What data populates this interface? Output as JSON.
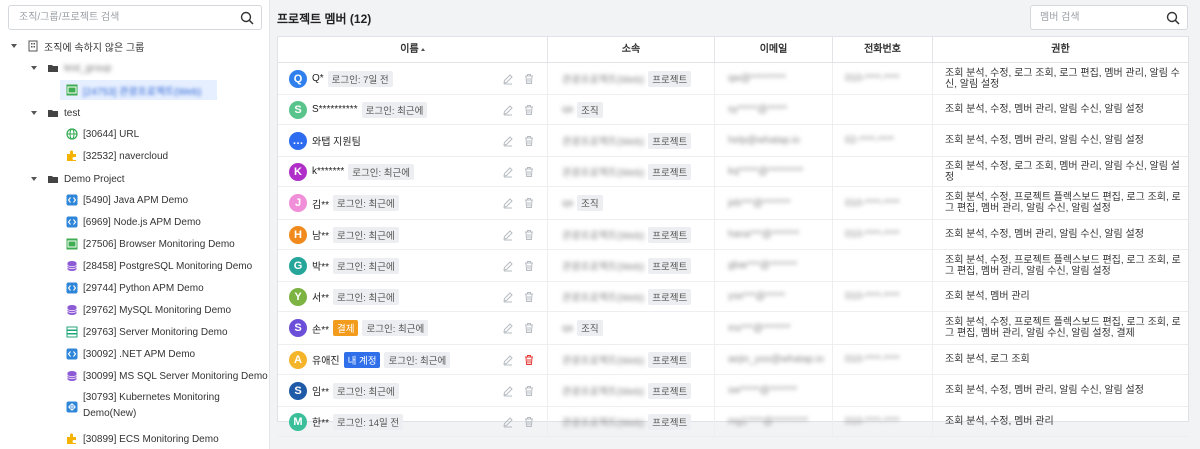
{
  "sidebar": {
    "search_placeholder": "조직/그룹/프로젝트 검색",
    "root_label": "조직에 속하지 않은 그룹",
    "group1_label": "test_group",
    "group1_project": "[24753] 관광프로젝트(Web)",
    "test_label": "test",
    "test_items": [
      "[30644] URL",
      "[32532] navercloud"
    ],
    "demo_label": "Demo Project",
    "demo_items": [
      "[5490] Java APM Demo",
      "[6969] Node.js APM Demo",
      "[27506] Browser Monitoring Demo",
      "[28458] PostgreSQL Monitoring Demo",
      "[29744] Python APM Demo",
      "[29762] MySQL Monitoring Demo",
      "[29763] Server Monitoring Demo",
      "[30092] .NET APM Demo",
      "[30099] MS SQL Server Monitoring Demo"
    ],
    "k8s_line1": "[30793] Kubernetes Monitoring",
    "k8s_line2": "Demo(New)",
    "ecs_label": "[30899] ECS Monitoring Demo"
  },
  "main": {
    "title": "프로젝트 멤버 (12)",
    "search_placeholder": "멤버 검색",
    "columns": {
      "name": "이름",
      "org": "소속",
      "email": "이메일",
      "phone": "전화번호",
      "perm": "권한"
    }
  },
  "members": [
    {
      "avatar": "Q",
      "color": "#2f80ed",
      "name": "Q*",
      "login": "로그인: 7일 전",
      "org": "관광프로젝트(Web)",
      "type": "프로젝트",
      "email": "qw@*********",
      "phone": "010-****-****",
      "perm": "조회 분석, 수정, 로그 조회, 로그 편집, 멤버 관리, 알림 수신, 알림 설정"
    },
    {
      "avatar": "S",
      "color": "#58c48b",
      "name": "S**********",
      "login": "로그인: 최근에",
      "org": "qa",
      "type": "조직",
      "email": "sy*****@*****",
      "phone": "",
      "perm": "조회 분석, 수정, 멤버 관리, 알림 수신, 알림 설정"
    },
    {
      "avatar": "…",
      "color": "#2d6cf0",
      "name": "와탭 지원팀",
      "login": "",
      "org": "관광프로젝트(Web)",
      "type": "프로젝트",
      "email": "help@whatap.io",
      "phone": "02-****-****",
      "perm": "조회 분석, 수정, 멤버 관리, 알림 수신, 알림 설정"
    },
    {
      "avatar": "K",
      "color": "#b02fc8",
      "name": "k*******",
      "login": "로그인: 최근에",
      "org": "관광프로젝트(Web)",
      "type": "프로젝트",
      "email": "kq*****@*********",
      "phone": "",
      "perm": "조회 분석, 수정, 로그 조회, 멤버 관리, 알림 수신, 알림 설정"
    },
    {
      "avatar": "J",
      "color": "#f08fd8",
      "name": "김**",
      "login": "로그인: 최근에",
      "org": "qa",
      "type": "조직",
      "email": "jeb***@*******",
      "phone": "010-****-****",
      "perm": "조회 분석, 수정, 프로젝트 플렉스보드 편집, 로그 조회, 로그 편집, 멤버 관리, 알림 수신, 알림 설정"
    },
    {
      "avatar": "H",
      "color": "#f08a1c",
      "name": "남**",
      "login": "로그인: 최근에",
      "org": "관광프로젝트(Web)",
      "type": "프로젝트",
      "email": "hana***@*******",
      "phone": "010-****-****",
      "perm": "조회 분석, 수정, 멤버 관리, 알림 수신, 알림 설정"
    },
    {
      "avatar": "G",
      "color": "#26a69a",
      "name": "박**",
      "login": "로그인: 최근에",
      "org": "관광프로젝트(Web)",
      "type": "프로젝트",
      "email": "gbar***@*******",
      "phone": "",
      "perm": "조회 분석, 수정, 프로젝트 플렉스보드 편집, 로그 조회, 로그 편집, 멤버 관리, 알림 수신, 알림 설정"
    },
    {
      "avatar": "Y",
      "color": "#7cb342",
      "name": "서**",
      "login": "로그인: 최근에",
      "org": "관광프로젝트(Web)",
      "type": "프로젝트",
      "email": "yse***@*****",
      "phone": "010-****-****",
      "perm": "조회 분석, 멤버 관리"
    },
    {
      "avatar": "S",
      "color": "#6c4fd8",
      "name": "손**",
      "badge": "결제",
      "badge_color": "#f29b1d",
      "login": "로그인: 최근에",
      "org": "qa",
      "type": "조직",
      "email": "ms***@*******",
      "phone": "",
      "perm": "조회 분석, 수정, 프로젝트 플렉스보드 편집, 로그 조회, 로그 편집, 멤버 관리, 알림 수신, 알림 설정, 결제"
    },
    {
      "avatar": "A",
      "color": "#f5b52a",
      "name": "유애진",
      "badge": "내 계정",
      "badge_color": "#2f6fea",
      "login": "로그인: 최근에",
      "org": "관광프로젝트(Web)",
      "type": "프로젝트",
      "email": "aejin_yoo@whatap.io",
      "phone": "010-****-****",
      "perm": "조회 분석, 로그 조회",
      "self": true
    },
    {
      "avatar": "S",
      "color": "#1e5aa8",
      "name": "임**",
      "login": "로그인: 최근에",
      "org": "관광프로젝트(Web)",
      "type": "프로젝트",
      "email": "sw*****@*******",
      "phone": "",
      "perm": "조회 분석, 수정, 멤버 관리, 알림 수신, 알림 설정"
    },
    {
      "avatar": "M",
      "color": "#3bbf9a",
      "name": "한**",
      "login": "로그인: 14일 전",
      "org": "관광프로젝트(Web)",
      "type": "프로젝트",
      "email": "mg1****@*********",
      "phone": "010-****-****",
      "perm": "조회 분석, 수정, 멤버 관리"
    }
  ],
  "colors": {
    "accent": "#2f6fea",
    "danger": "#e53935",
    "selected": "#e6efff"
  }
}
